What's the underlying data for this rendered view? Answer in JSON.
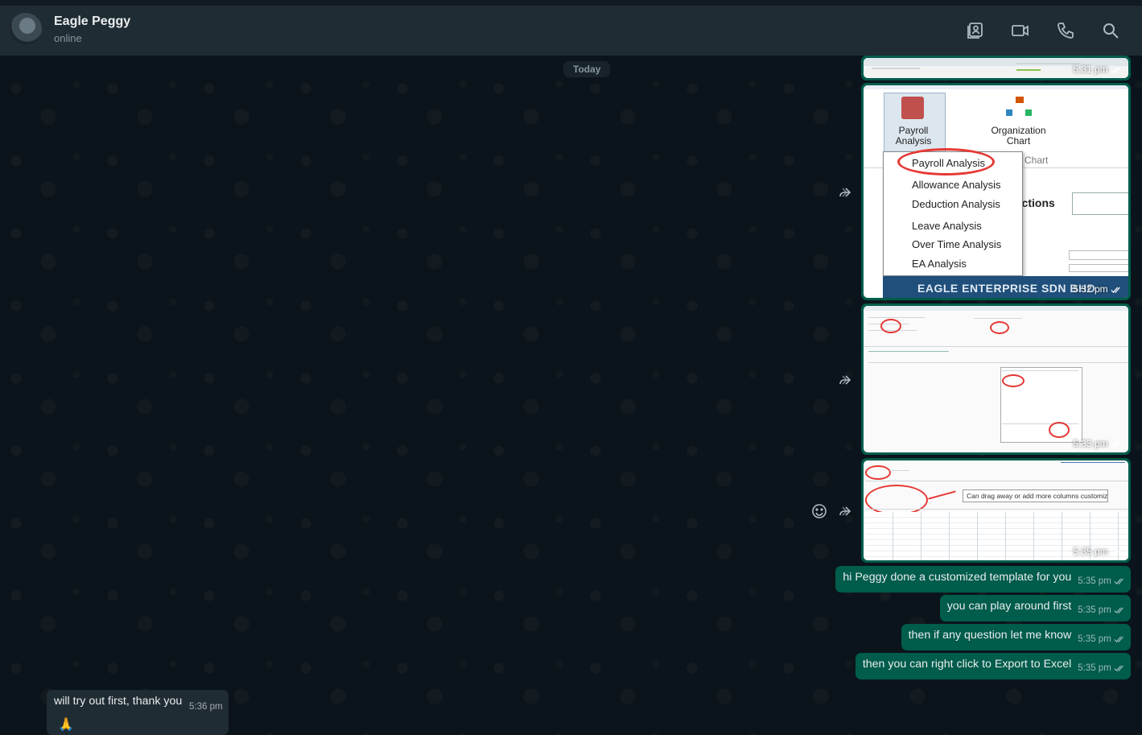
{
  "header": {
    "contact_name": "Eagle Peggy",
    "status": "online",
    "icons": [
      "contact-card-icon",
      "video-call-icon",
      "phone-icon",
      "search-icon"
    ]
  },
  "chat": {
    "day_label": "Today",
    "images": [
      {
        "time": "5:31 pm"
      },
      {
        "time": "5:32 pm",
        "toolbar": {
          "payroll": "Payroll\nAnalysis",
          "org": "Organization\nChart",
          "partial_chart": "n Chart",
          "partial_section": "nctions"
        },
        "menu_items": [
          "Payroll Analysis",
          "Allowance Analysis",
          "Deduction Analysis",
          "Leave Analysis",
          "Over Time Analysis",
          "EA Analysis"
        ],
        "footer_banner": "EAGLE ENTERPRISE SDN BHD"
      },
      {
        "time": "5:33 pm"
      },
      {
        "time": "5:35 pm",
        "note": "Can drag away or add more columns customize"
      }
    ],
    "outgoing": [
      {
        "text": "hi Peggy done a customized template for you",
        "time": "5:35 pm"
      },
      {
        "text": "you can play around first",
        "time": "5:35 pm"
      },
      {
        "text": "then if any question let me know",
        "time": "5:35 pm"
      },
      {
        "text": "then you can right click to Export to Excel",
        "time": "5:35 pm"
      }
    ],
    "incoming": [
      {
        "text": "will try out first, thank you",
        "time": "5:36 pm",
        "emoji": "🙏"
      }
    ]
  },
  "colors": {
    "outgoing_bubble": "#005c4b",
    "incoming_bubble": "#202c33",
    "background": "#0b141a",
    "header": "#202c33"
  }
}
